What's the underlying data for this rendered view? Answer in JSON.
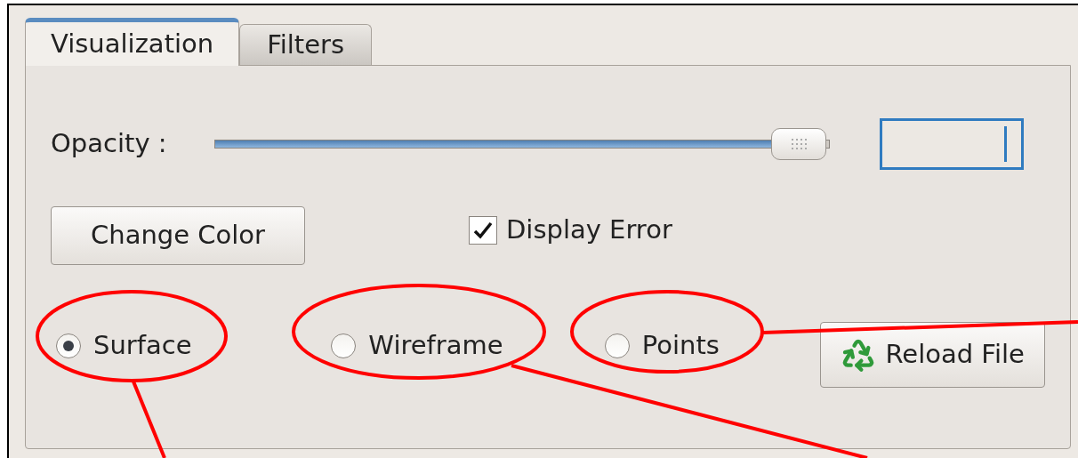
{
  "tabs": [
    {
      "label": "Visualization",
      "selected": true
    },
    {
      "label": "Filters",
      "selected": false
    }
  ],
  "opacity": {
    "label": "Opacity :",
    "level": 0.95
  },
  "change_color_button": "Change Color",
  "display_error": {
    "label": "Display Error",
    "checked": true
  },
  "render_modes": [
    {
      "label": "Surface",
      "selected": true
    },
    {
      "label": "Wireframe",
      "selected": false
    },
    {
      "label": "Points",
      "selected": false
    }
  ],
  "reload_button": "Reload File"
}
